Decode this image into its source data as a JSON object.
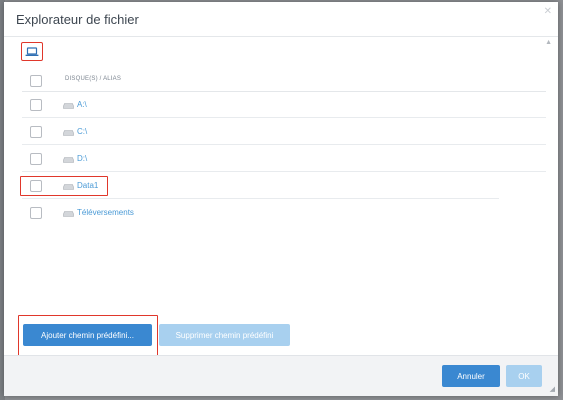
{
  "dialog": {
    "title": "Explorateur de fichier",
    "close_glyph": "✕",
    "scroll_up_glyph": "▲",
    "resize_glyph": "◢"
  },
  "toolbar": {
    "computer_icon": "laptop-icon"
  },
  "table": {
    "header": "DISQUE(S) / ALIAS",
    "rows": [
      {
        "label": "A:\\",
        "icon": "drive-icon",
        "checked": false,
        "highlighted": false
      },
      {
        "label": "C:\\",
        "icon": "drive-icon",
        "checked": false,
        "highlighted": false
      },
      {
        "label": "D:\\",
        "icon": "drive-icon",
        "checked": false,
        "highlighted": false
      },
      {
        "label": "Data1",
        "icon": "drive-icon",
        "checked": false,
        "highlighted": true
      },
      {
        "label": "Téléversements",
        "icon": "drive-icon",
        "checked": false,
        "highlighted": false
      }
    ]
  },
  "actions": {
    "add_preset": "Ajouter chemin prédéfini...",
    "remove_preset": "Supprimer chemin prédéfini"
  },
  "footer": {
    "cancel": "Annuler",
    "ok": "OK"
  },
  "colors": {
    "accent": "#3a88d1",
    "accent_disabled": "#a8d0ef",
    "link": "#4a9ad6",
    "highlight": "#e0372b"
  }
}
